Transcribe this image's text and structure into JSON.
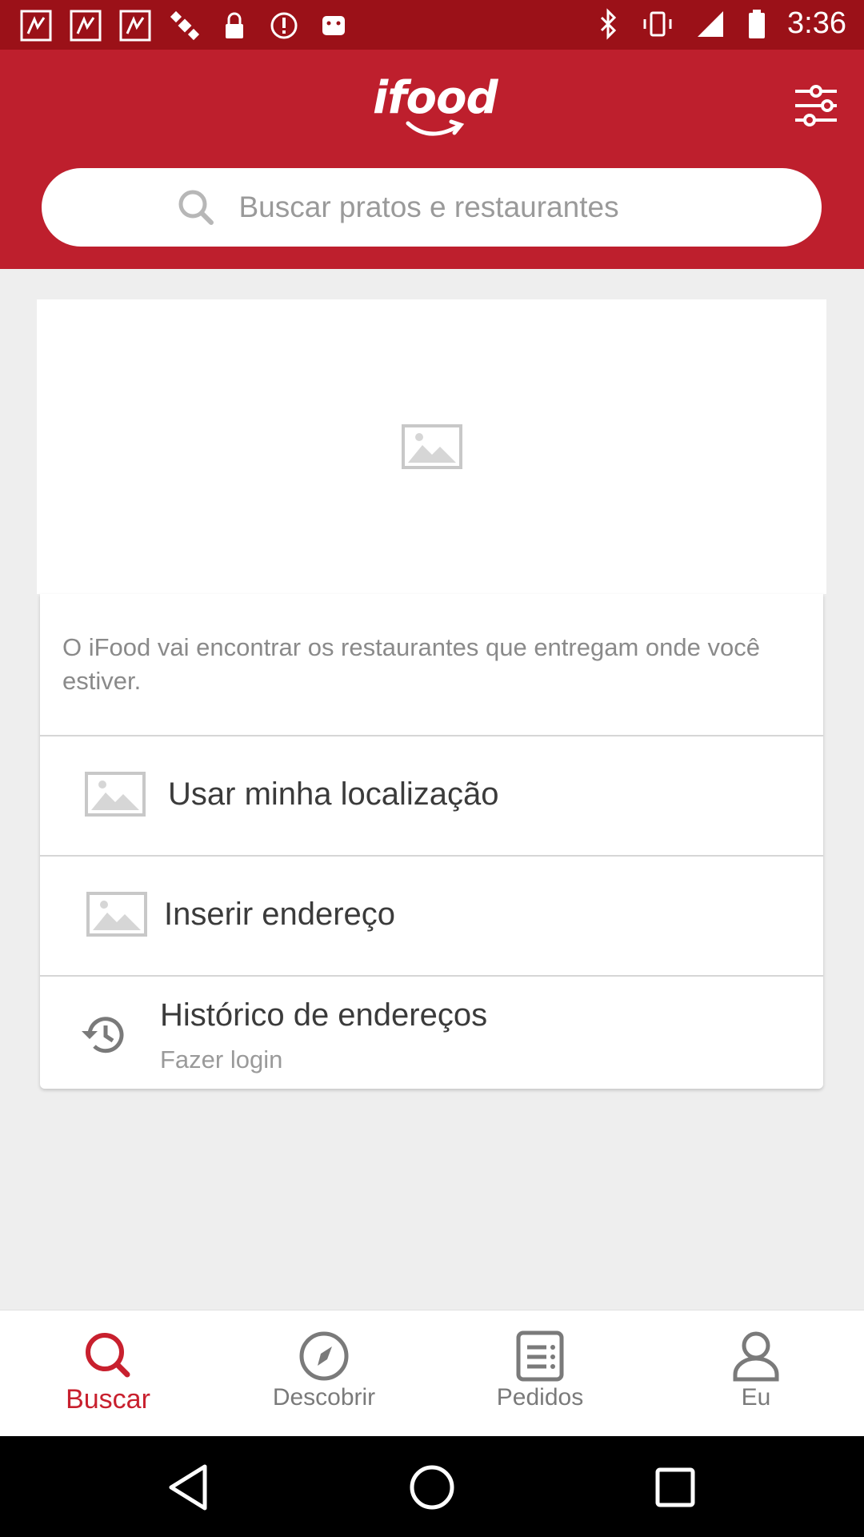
{
  "status_bar": {
    "time": "3:36",
    "left_icons": [
      "notification-icon",
      "notification-icon",
      "notification-icon",
      "satellite-icon",
      "lock-icon",
      "alert-icon",
      "android-icon"
    ],
    "right_icons": [
      "bluetooth-icon",
      "vibrate-icon",
      "signal-icon",
      "battery-icon"
    ]
  },
  "header": {
    "logo_text": "ifood",
    "brand_color": "#be1f2d"
  },
  "search": {
    "placeholder": "Buscar pratos e restaurantes"
  },
  "location_card": {
    "intro": "O iFood vai encontrar os restaurantes que entregam onde você estiver.",
    "options": [
      {
        "label": "Usar minha localização",
        "icon": "image-placeholder-icon"
      },
      {
        "label": "Inserir endereço",
        "icon": "image-placeholder-icon"
      }
    ],
    "history": {
      "label": "Histórico de endereços",
      "sublabel": "Fazer login",
      "icon": "history-icon"
    }
  },
  "bottom_nav": {
    "items": [
      {
        "label": "Buscar",
        "icon": "search-icon",
        "active": true
      },
      {
        "label": "Descobrir",
        "icon": "compass-icon",
        "active": false
      },
      {
        "label": "Pedidos",
        "icon": "orders-icon",
        "active": false
      },
      {
        "label": "Eu",
        "icon": "profile-icon",
        "active": false
      }
    ],
    "active_color": "#c8202e"
  },
  "android_nav": [
    "back-icon",
    "home-icon",
    "recents-icon"
  ]
}
